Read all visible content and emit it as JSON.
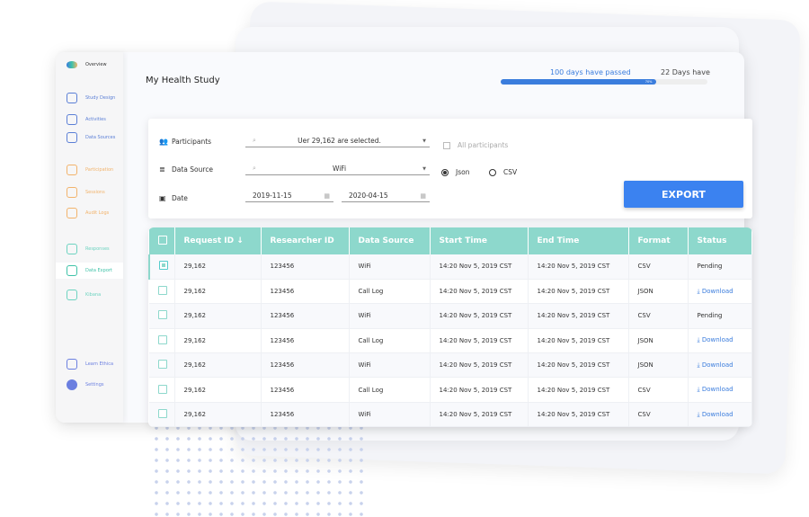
{
  "sidebar": {
    "items": [
      {
        "label": "Overview",
        "icon": "brain-icon",
        "color": "#333333"
      },
      {
        "label": "Study Design",
        "icon": "gauge-icon",
        "color": "#5b7fd6"
      },
      {
        "label": "Activities",
        "icon": "document-icon",
        "color": "#5b7fd6"
      },
      {
        "label": "Data Sources",
        "icon": "database-icon",
        "color": "#5b7fd6"
      },
      {
        "label": "Participation",
        "icon": "users-icon",
        "color": "#f2b36b"
      },
      {
        "label": "Sessions",
        "icon": "calendar-icon",
        "color": "#f2b36b"
      },
      {
        "label": "Audit Logs",
        "icon": "history-icon",
        "color": "#f2b36b"
      },
      {
        "label": "Responses",
        "icon": "edit-icon",
        "color": "#6dd3c0"
      },
      {
        "label": "Data Export",
        "icon": "export-icon",
        "color": "#3fc2a8"
      },
      {
        "label": "Kibana",
        "icon": "chart-icon",
        "color": "#6dd3c0"
      },
      {
        "label": "Learn Ethica",
        "icon": "help-icon",
        "color": "#6b7fe0"
      },
      {
        "label": "Settings",
        "icon": "settings-icon",
        "color": "#6b7fe0"
      }
    ]
  },
  "header": {
    "title": "My Health Study",
    "passed": "100 days have passed",
    "remaining": "22 Days have",
    "progress_label": "70%",
    "progress": 0.75
  },
  "filter": {
    "participants_label": "Participants",
    "participants_value": "Uer 29,162 are selected.",
    "all_participants": "All participants",
    "source_label": "Data Source",
    "source_value": "WiFi",
    "date_label": "Date",
    "date_from": "2019-11-15",
    "date_to": "2020-04-15",
    "json": "Json",
    "csv": "CSV",
    "export": "EXPORT"
  },
  "table": {
    "headers": [
      "Request ID ↓",
      "Researcher ID",
      "Data Source",
      "Start Time",
      "End Time",
      "Format",
      "Status"
    ],
    "rows": [
      [
        "29,162",
        "123456",
        "WiFi",
        "14:20 Nov 5, 2019 CST",
        "14:20 Nov 5, 2019 CST",
        "CSV",
        "Pending"
      ],
      [
        "29,162",
        "123456",
        "Call Log",
        "14:20 Nov 5, 2019 CST",
        "14:20 Nov 5, 2019 CST",
        "JSON",
        "⤓ Download"
      ],
      [
        "29,162",
        "123456",
        "WiFi",
        "14:20 Nov 5, 2019 CST",
        "14:20 Nov 5, 2019 CST",
        "CSV",
        "Pending"
      ],
      [
        "29,162",
        "123456",
        "Call Log",
        "14:20 Nov 5, 2019 CST",
        "14:20 Nov 5, 2019 CST",
        "JSON",
        "⤓ Download"
      ],
      [
        "29,162",
        "123456",
        "WiFi",
        "14:20 Nov 5, 2019 CST",
        "14:20 Nov 5, 2019 CST",
        "JSON",
        "⤓ Download"
      ],
      [
        "29,162",
        "123456",
        "Call Log",
        "14:20 Nov 5, 2019 CST",
        "14:20 Nov 5, 2019 CST",
        "CSV",
        "⤓ Download"
      ],
      [
        "29,162",
        "123456",
        "WiFi",
        "14:20 Nov 5, 2019 CST",
        "14:20 Nov 5, 2019 CST",
        "CSV",
        "⤓ Download"
      ]
    ]
  }
}
